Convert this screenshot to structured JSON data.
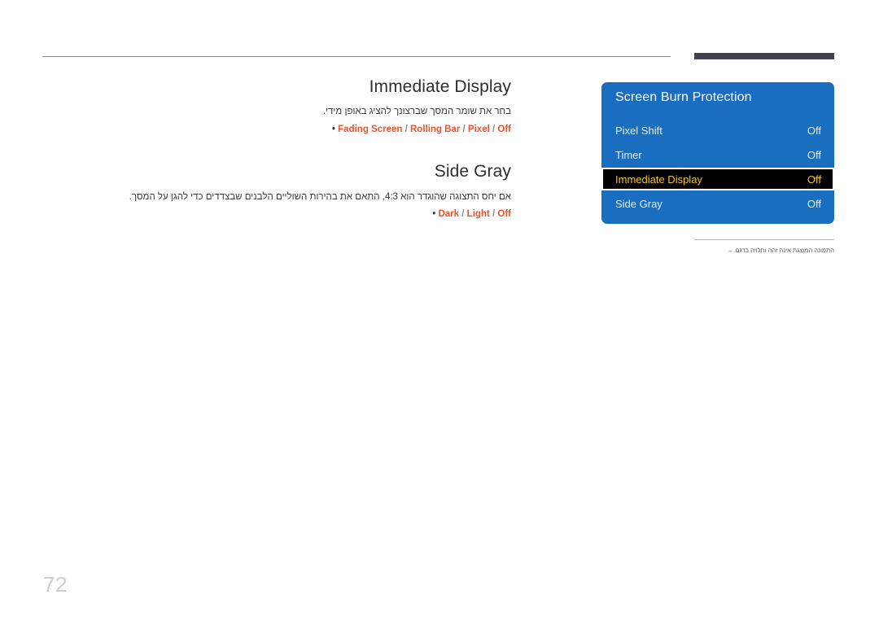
{
  "header": {
    "rule_label": "header-rule",
    "bar_label": "header-bar"
  },
  "sections": [
    {
      "title": "Immediate Display",
      "body": "בחר את שומר המסך שברצונך להציג באופן מידי.",
      "options": "Fading Screen / Rolling Bar / Pixel / Off",
      "bullet": "•"
    },
    {
      "title": "Side Gray",
      "body": "אם יחס התצוגה שהוגדר הוא 4:3, התאם את בהירות השוליים הלבנים שבצדדים כדי להגן על המסך.",
      "options": "Dark / Light / Off",
      "bullet": "•"
    }
  ],
  "osd": {
    "title": "Screen Burn Protection",
    "rows": [
      {
        "label": "Pixel Shift",
        "value": "Off",
        "selected": false
      },
      {
        "label": "Timer",
        "value": "Off",
        "selected": false
      },
      {
        "label": "Immediate Display",
        "value": "Off",
        "selected": true
      },
      {
        "label": "Side Gray",
        "value": "Off",
        "selected": false
      }
    ],
    "colors": {
      "panel_bg": "#1a6ec0",
      "selected_bg": "#000000",
      "selected_text": "#f5c518",
      "row_text": "#e2ecf8"
    }
  },
  "note": {
    "dash": "–",
    "text": "התמונה המוצגת אינה זהה ותלויה בדגם."
  },
  "page": {
    "number": "72"
  },
  "colors": {
    "accent_orange": "#e8552d",
    "header_bar": "#45414f",
    "page_number": "#c9cdd4"
  }
}
